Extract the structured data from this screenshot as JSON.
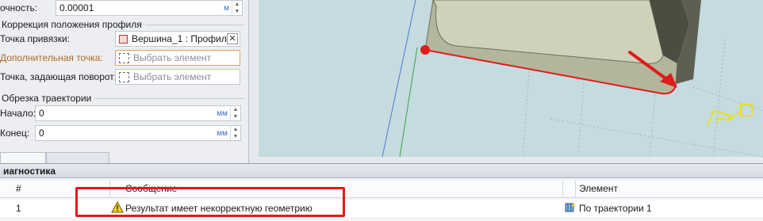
{
  "panel": {
    "accuracy": {
      "label": "очность:",
      "value": "0.00001",
      "unit": "м"
    },
    "profile_correction": {
      "title": "Коррекция положения профиля",
      "anchor_point": {
        "label": "Точка привязки:",
        "value": "Вершина_1 : Профиль..."
      },
      "additional_point": {
        "label": "Дополнительная точка:",
        "placeholder": "Выбрать элемент"
      },
      "rotation_point": {
        "label": "Точка, задающая поворот:",
        "placeholder": "Выбрать элемент"
      }
    },
    "trim": {
      "title": "Обрезка траектории",
      "start": {
        "label": "Начало:",
        "value": "0",
        "unit": "мм"
      },
      "end": {
        "label": "Конец:",
        "value": "0",
        "unit": "мм"
      }
    }
  },
  "diagnostics": {
    "title": "иагностика",
    "columns": {
      "num": "#",
      "message": "Сообщение",
      "element": "Элемент"
    },
    "rows": [
      {
        "num": "1",
        "message": "Результат имеет некорректную геометрию",
        "element": "По траектории 1"
      }
    ]
  },
  "colors": {
    "highlight": "#e01b1b",
    "model": "#b4b69e",
    "accent_unit": "#3a6fc7"
  }
}
